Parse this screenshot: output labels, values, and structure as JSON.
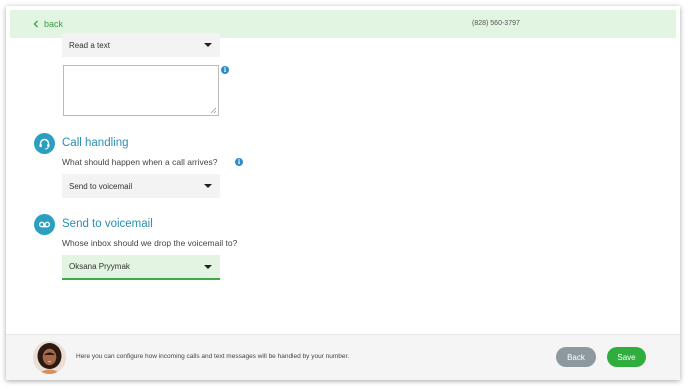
{
  "header": {
    "back_label": "back",
    "phone_number": "(828) 560-3797"
  },
  "message": {
    "action_select_value": "Read a text",
    "text_value": ""
  },
  "call_handling": {
    "title": "Call handling",
    "question": "What should happen when a call arrives?",
    "select_value": "Send to voicemail"
  },
  "voicemail": {
    "title": "Send to voicemail",
    "question": "Whose inbox should we drop the voicemail to?",
    "select_value": "Oksana Pryymak"
  },
  "footer": {
    "help_text": "Here you can configure how incoming calls and text messages will be handled by your number.",
    "back_button": "Back",
    "save_button": "Save"
  },
  "icons": {
    "info": "i"
  },
  "colors": {
    "accent_green": "#2fae3e",
    "header_bg": "#e2f4e2",
    "section_blue": "#2a9fbf",
    "back_button_gray": "#8e989f"
  }
}
